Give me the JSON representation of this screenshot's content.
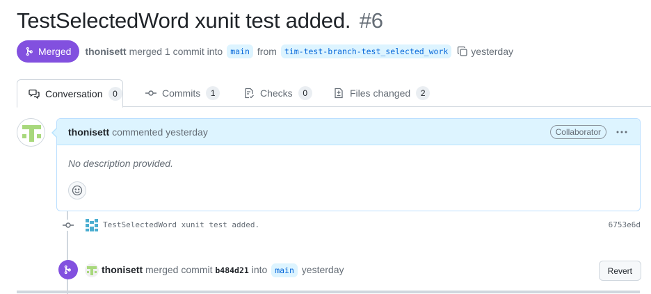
{
  "pr": {
    "title": "TestSelectedWord xunit test added.",
    "number": "#6",
    "state": "Merged",
    "author": "thonisett",
    "summary_merged": "merged 1 commit into",
    "base_branch": "main",
    "from_text": "from",
    "head_branch": "tim-test-branch-test_selected_work",
    "time": "yesterday"
  },
  "tabs": [
    {
      "label": "Conversation",
      "count": "0"
    },
    {
      "label": "Commits",
      "count": "1"
    },
    {
      "label": "Checks",
      "count": "0"
    },
    {
      "label": "Files changed",
      "count": "2"
    }
  ],
  "comment": {
    "author": "thonisett",
    "action": "commented yesterday",
    "role": "Collaborator",
    "body": "No description provided."
  },
  "commit": {
    "message": "TestSelectedWord xunit test added.",
    "sha": "6753e6d"
  },
  "merge_event": {
    "author": "thonisett",
    "text1": "merged commit",
    "sha": "b484d21",
    "text2": "into",
    "branch": "main",
    "time": "yesterday",
    "revert_label": "Revert"
  },
  "colors": {
    "merged": "#8250df",
    "link": "#0969da",
    "header_bg": "#ddf4ff",
    "identicon": "#a8d87c"
  },
  "icons": [
    "git-merge-icon",
    "copy-icon",
    "comment-discussion-icon",
    "git-commit-icon",
    "checklist-icon",
    "file-diff-icon",
    "kebab-horizontal-icon",
    "smiley-icon"
  ]
}
